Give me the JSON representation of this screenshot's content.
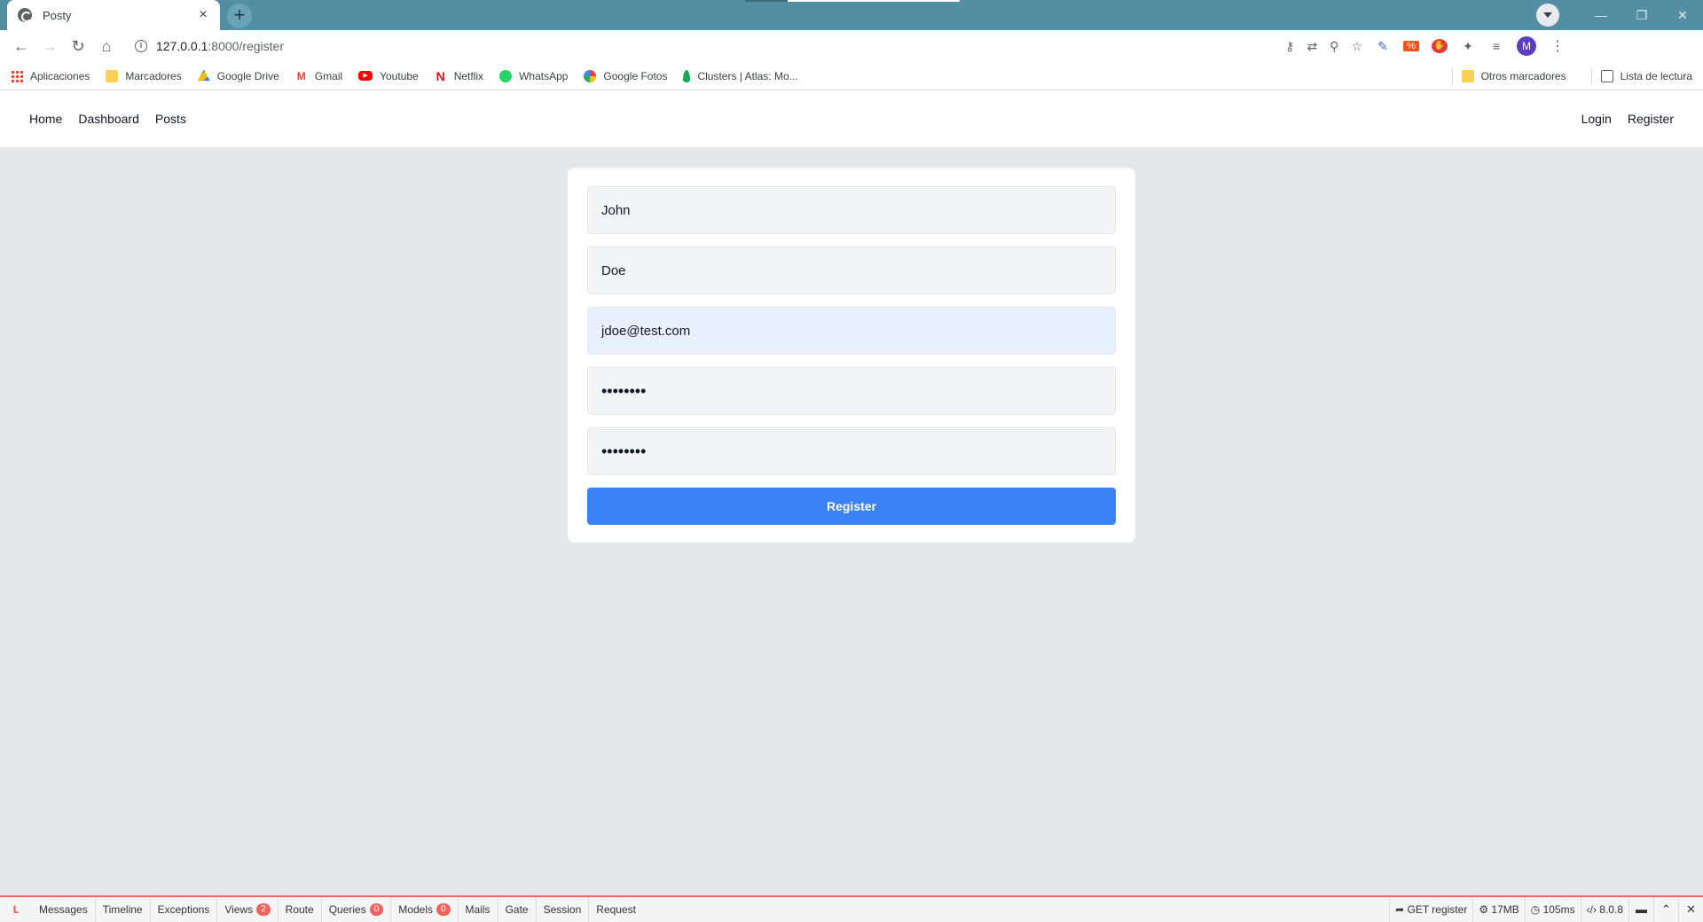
{
  "browser": {
    "tab_title": "Posty",
    "tab_close": "×",
    "new_tab": "+",
    "window_controls": {
      "minimize": "—",
      "restore": "❐",
      "close": "✕"
    },
    "url_host": "127.0.0.1",
    "url_path": ":8000/register",
    "avatar_letter": "M"
  },
  "bookmarks": {
    "items": [
      {
        "label": "Aplicaciones",
        "icon": "apps-grid-icon"
      },
      {
        "label": "Marcadores",
        "icon": "folder-icon",
        "color": "#f9cf54"
      },
      {
        "label": "Google Drive",
        "icon": "google-drive-icon",
        "color": "#34a853"
      },
      {
        "label": "Gmail",
        "icon": "gmail-icon",
        "color": "#ea4335"
      },
      {
        "label": "Youtube",
        "icon": "youtube-icon",
        "color": "#ff0000"
      },
      {
        "label": "Netflix",
        "icon": "netflix-icon",
        "color": "#e50914"
      },
      {
        "label": "WhatsApp",
        "icon": "whatsapp-icon",
        "color": "#25d366"
      },
      {
        "label": "Google Fotos",
        "icon": "google-photos-icon",
        "color": "#fbbc04"
      },
      {
        "label": "Clusters | Atlas: Mo...",
        "icon": "mongodb-leaf-icon",
        "color": "#13aa52"
      }
    ],
    "other": "Otros marcadores",
    "reading_list": "Lista de lectura"
  },
  "app_nav": {
    "left": [
      "Home",
      "Dashboard",
      "Posts"
    ],
    "right": [
      "Login",
      "Register"
    ]
  },
  "form": {
    "name": "John",
    "username": "Doe",
    "email": "jdoe@test.com",
    "password": "••••••••",
    "password_confirmation": "••••••••",
    "submit_label": "Register"
  },
  "debugbar": {
    "tabs": [
      {
        "label": "Messages"
      },
      {
        "label": "Timeline"
      },
      {
        "label": "Exceptions"
      },
      {
        "label": "Views",
        "badge": "2"
      },
      {
        "label": "Route"
      },
      {
        "label": "Queries",
        "badge": "0"
      },
      {
        "label": "Models",
        "badge": "0"
      },
      {
        "label": "Mails"
      },
      {
        "label": "Gate"
      },
      {
        "label": "Session"
      },
      {
        "label": "Request"
      }
    ],
    "route": "GET register",
    "memory": "17MB",
    "time": "105ms",
    "version": "8.0.8"
  },
  "colors": {
    "titlebar": "#548ea2",
    "primary_button": "#3b82f6",
    "debugbar_accent": "#f4645f",
    "page_bg": "#e5e7eb"
  }
}
